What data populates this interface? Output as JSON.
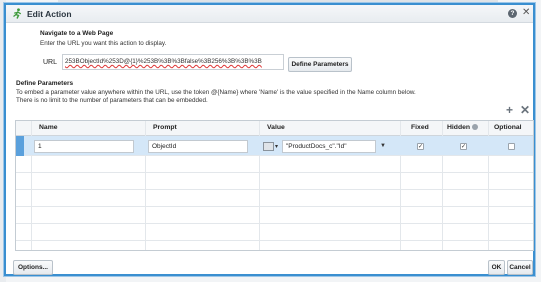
{
  "dialog": {
    "title": "Edit Action",
    "help_icon": "question-icon",
    "close_icon": "close-icon"
  },
  "navigate": {
    "heading": "Navigate to a Web Page",
    "instructions": "Enter the URL you want this action to display.",
    "url_label": "URL",
    "url_value": "253BObjectId%253D@{1}%253B%3B%3Bfalse%3B256%3B%3B%3B",
    "define_button": "Define Parameters"
  },
  "parameters": {
    "heading": "Define Parameters",
    "note_line1": "To embed a parameter value anywhere within the URL, use the token @{Name} where 'Name' is the value specified in the Name column below.",
    "note_line2": "There is no limit to the number of parameters that can be embedded.",
    "add_icon": "plus-icon",
    "remove_icon": "x-icon",
    "columns": {
      "name": "Name",
      "prompt": "Prompt",
      "value": "Value",
      "fixed": "Fixed",
      "hidden": "Hidden",
      "optional": "Optional"
    },
    "rows": [
      {
        "name": "1",
        "prompt": "ObjectId",
        "value": "\"ProductDocs_c\".\"Id\"",
        "fixed": true,
        "hidden": true,
        "optional": false
      }
    ]
  },
  "footer": {
    "options_button": "Options...",
    "ok_button": "OK",
    "cancel_button": "Cancel"
  },
  "colors": {
    "accent_border": "#3a8fd0",
    "selected_row": "#d4e7f8"
  }
}
